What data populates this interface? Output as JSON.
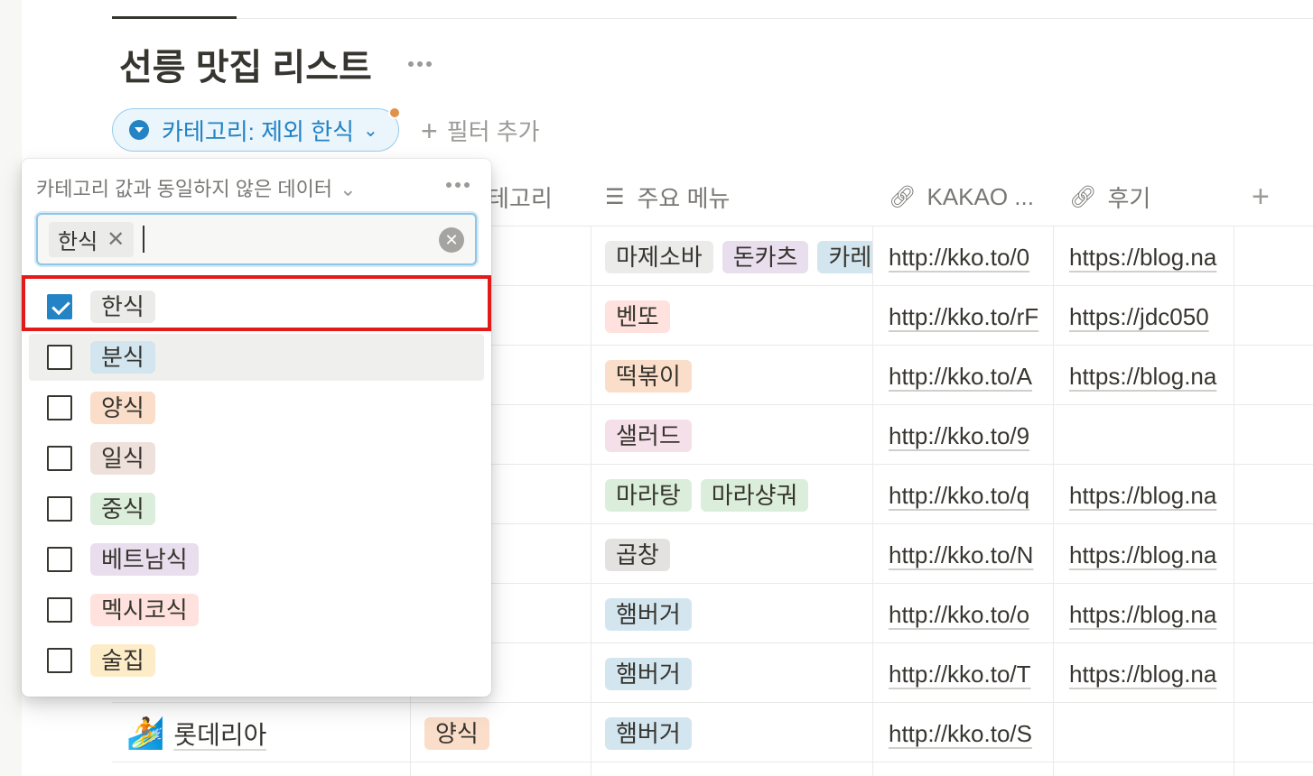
{
  "page": {
    "title": "선릉 맛집 리스트"
  },
  "filter": {
    "chip_label": "카테고리: 제외 한식",
    "add_label": "필터 추가"
  },
  "table": {
    "headers": {
      "category": "테고리",
      "menu": "주요 메뉴",
      "kakao": "KAKAO ...",
      "review": "후기"
    },
    "rows": [
      {
        "menus": [
          "마제소바",
          "돈카츠",
          "카레"
        ],
        "menu_colors": [
          "#ebebea",
          "#e8deee",
          "#d3e5ef"
        ],
        "kakao": "http://kko.to/0",
        "review": "https://blog.na"
      },
      {
        "menus": [
          "벤또"
        ],
        "menu_colors": [
          "#ffe2dd"
        ],
        "kakao": "http://kko.to/rF",
        "review": "https://jdc050"
      },
      {
        "menus": [
          "떡볶이"
        ],
        "menu_colors": [
          "#fadec9"
        ],
        "kakao": "http://kko.to/A",
        "review": "https://blog.na"
      },
      {
        "menus": [
          "샐러드"
        ],
        "menu_colors": [
          "#f5e0e9"
        ],
        "kakao": "http://kko.to/9",
        "review": ""
      },
      {
        "menus": [
          "마라탕",
          "마라샹궈"
        ],
        "menu_colors": [
          "#dbeddb",
          "#dbeddb"
        ],
        "kakao": "http://kko.to/q",
        "review": "https://blog.na"
      },
      {
        "menus": [
          "곱창"
        ],
        "menu_colors": [
          "#e3e2e0"
        ],
        "kakao": "http://kko.to/N",
        "review": "https://blog.na"
      },
      {
        "menus": [
          "햄버거"
        ],
        "menu_colors": [
          "#d3e5ef"
        ],
        "kakao": "http://kko.to/o",
        "review": "https://blog.na"
      },
      {
        "menus": [
          "햄버거"
        ],
        "menu_colors": [
          "#d3e5ef"
        ],
        "kakao": "http://kko.to/T",
        "review": "https://blog.na"
      },
      {
        "name": "롯데리아",
        "icon": "🏄",
        "category": "양식",
        "category_color": "#fadec9",
        "menus": [
          "햄버거"
        ],
        "menu_colors": [
          "#d3e5ef"
        ],
        "kakao": "http://kko.to/S",
        "review": ""
      }
    ]
  },
  "dropdown": {
    "title": "카테고리 값과 동일하지 않은 데이터",
    "selected_token": "한식",
    "options": [
      {
        "label": "한식",
        "checked": true,
        "color": "#ebebea"
      },
      {
        "label": "분식",
        "checked": false,
        "color": "#d3e5ef"
      },
      {
        "label": "양식",
        "checked": false,
        "color": "#fadec9"
      },
      {
        "label": "일식",
        "checked": false,
        "color": "#eee0da"
      },
      {
        "label": "중식",
        "checked": false,
        "color": "#dbeddb"
      },
      {
        "label": "베트남식",
        "checked": false,
        "color": "#e8deee"
      },
      {
        "label": "멕시코식",
        "checked": false,
        "color": "#ffe2dd"
      },
      {
        "label": "술집",
        "checked": false,
        "color": "#fdecc8"
      }
    ]
  },
  "colors": {
    "accent": "#2383c4",
    "highlight": "#e21a1a",
    "filter_dot": "#e0924a"
  }
}
